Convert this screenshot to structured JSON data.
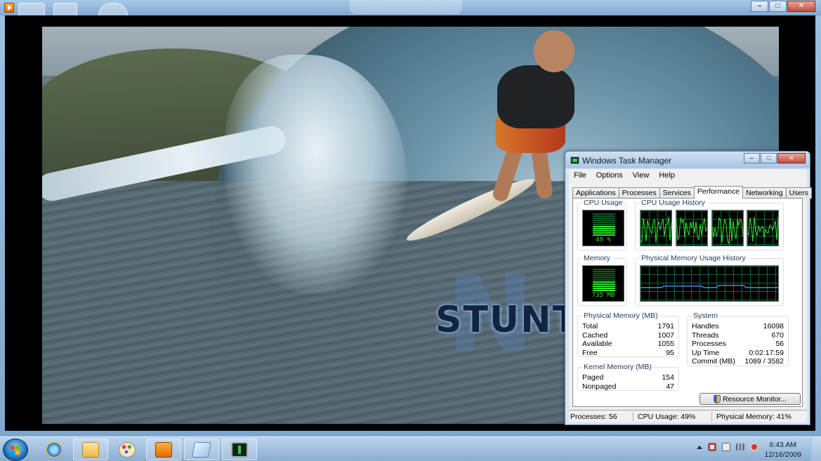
{
  "player": {
    "title_overlay": "STUNT",
    "caption_minimize": "–",
    "caption_maximize": "□",
    "caption_close": "✕"
  },
  "task_manager": {
    "title": "Windows Task Manager",
    "caption_minimize": "–",
    "caption_maximize": "□",
    "caption_close": "✕",
    "menu": [
      "File",
      "Options",
      "View",
      "Help"
    ],
    "tabs": [
      "Applications",
      "Processes",
      "Services",
      "Performance",
      "Networking",
      "Users"
    ],
    "active_tab": "Performance",
    "cpu_usage": {
      "label": "CPU Usage",
      "value": "49 %",
      "fraction": 0.49
    },
    "cpu_history": {
      "label": "CPU Usage History",
      "cores": 4
    },
    "memory": {
      "label": "Memory",
      "value": "735 MB",
      "fraction": 0.41
    },
    "memory_history": {
      "label": "Physical Memory Usage History"
    },
    "physical_memory": {
      "label": "Physical Memory (MB)",
      "rows": [
        {
          "name": "Total",
          "value": "1791"
        },
        {
          "name": "Cached",
          "value": "1007"
        },
        {
          "name": "Available",
          "value": "1055"
        },
        {
          "name": "Free",
          "value": "95"
        }
      ]
    },
    "kernel_memory": {
      "label": "Kernel Memory (MB)",
      "rows": [
        {
          "name": "Paged",
          "value": "154"
        },
        {
          "name": "Nonpaged",
          "value": "47"
        }
      ]
    },
    "system": {
      "label": "System",
      "rows": [
        {
          "name": "Handles",
          "value": "16098"
        },
        {
          "name": "Threads",
          "value": "670"
        },
        {
          "name": "Processes",
          "value": "56"
        },
        {
          "name": "Up Time",
          "value": "0:02:17:59"
        },
        {
          "name": "Commit (MB)",
          "value": "1089 / 3582"
        }
      ]
    },
    "resource_monitor_button": "Resource Monitor...",
    "status": {
      "processes": "Processes: 56",
      "cpu": "CPU Usage: 49%",
      "memory": "Physical Memory: 41%"
    }
  },
  "taskbar": {
    "time": "6:43 AM",
    "date": "12/16/2009",
    "buttons": [
      "internet-explorer-icon",
      "folder-icon",
      "paint-icon",
      "media-player-icon",
      "notepad-icon",
      "task-manager-icon"
    ]
  },
  "colors": {
    "graph_green": "#2ee82e",
    "graph_grid": "#0a6b37",
    "memory_line": "#3b8fe8",
    "meter_dim": "#0b5b24"
  }
}
